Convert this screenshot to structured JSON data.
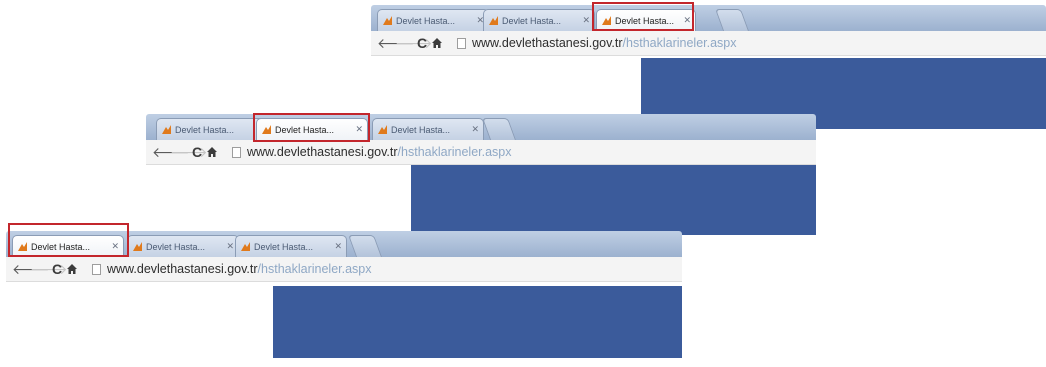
{
  "windows": [
    {
      "tabs": [
        {
          "title": "Devlet Hasta...",
          "active": false,
          "highlighted": false
        },
        {
          "title": "Devlet Hasta...",
          "active": false,
          "highlighted": false
        },
        {
          "title": "Devlet Hasta...",
          "active": true,
          "highlighted": true
        }
      ],
      "url": {
        "domain": "www.devlethastanesi.gov.tr",
        "path": "/hsthaklarineler.aspx"
      }
    },
    {
      "tabs": [
        {
          "title": "Devlet Hasta...",
          "active": false,
          "highlighted": false
        },
        {
          "title": "Devlet Hasta...",
          "active": true,
          "highlighted": true
        },
        {
          "title": "Devlet Hasta...",
          "active": false,
          "highlighted": false
        }
      ],
      "url": {
        "domain": "www.devlethastanesi.gov.tr",
        "path": "/hsthaklarineler.aspx"
      }
    },
    {
      "tabs": [
        {
          "title": "Devlet Hasta...",
          "active": true,
          "highlighted": true
        },
        {
          "title": "Devlet Hasta...",
          "active": false,
          "highlighted": false
        },
        {
          "title": "Devlet Hasta...",
          "active": false,
          "highlighted": false
        }
      ],
      "url": {
        "domain": "www.devlethastanesi.gov.tr",
        "path": "/hsthaklarineler.aspx"
      }
    }
  ],
  "nav_icons": {
    "back": "back-arrow-icon",
    "forward": "forward-arrow-icon",
    "reload": "reload-icon",
    "home": "home-icon",
    "page": "page-icon"
  },
  "colors": {
    "content": "#3b5b9b",
    "highlight": "#c3262c",
    "tabstrip": "#a9bcd6"
  }
}
